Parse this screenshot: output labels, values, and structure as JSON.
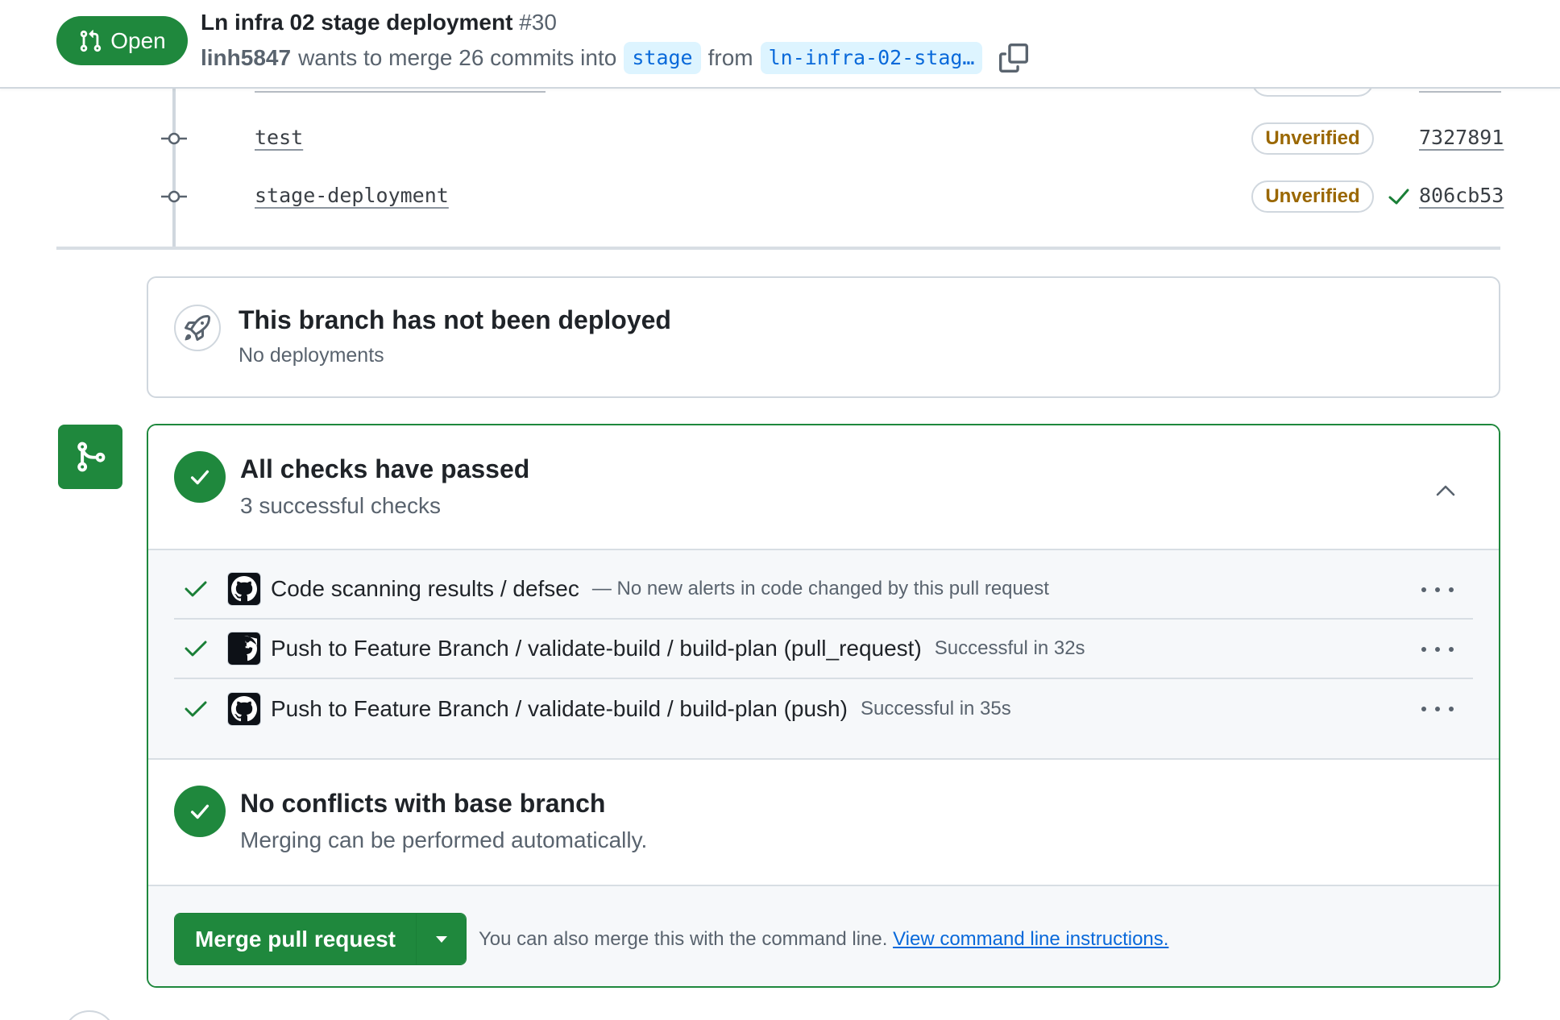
{
  "header": {
    "state": "Open",
    "title": "Ln infra 02 stage deployment",
    "number": "#30",
    "author": "linh5847",
    "merge_text": "wants to merge 26 commits into",
    "base_branch": "stage",
    "from_text": "from",
    "head_branch": "ln-infra-02-stag…"
  },
  "commits": [
    {
      "message": "test",
      "status": "Unverified",
      "sha": "7327891"
    },
    {
      "message": "stage-deployment",
      "status": "Unverified",
      "sha": "806cb53"
    }
  ],
  "deployment": {
    "title": "This branch has not been deployed",
    "subtitle": "No deployments"
  },
  "checks": {
    "title": "All checks have passed",
    "subtitle": "3 successful checks",
    "items": [
      {
        "name": "Code scanning results / defsec",
        "description": "— No new alerts in code changed by this pull request"
      },
      {
        "name": "Push to Feature Branch / validate-build / build-plan (pull_request)",
        "description": "Successful in 32s"
      },
      {
        "name": "Push to Feature Branch / validate-build / build-plan (push)",
        "description": "Successful in 35s"
      }
    ]
  },
  "conflicts": {
    "title": "No conflicts with base branch",
    "subtitle": "Merging can be performed automatically."
  },
  "merge": {
    "button_label": "Merge pull request",
    "hint": "You can also merge this with the command line.",
    "link": "View command line instructions."
  },
  "colors": {
    "success": "#1f883d",
    "warning": "#9a6700",
    "link": "#0969da"
  }
}
